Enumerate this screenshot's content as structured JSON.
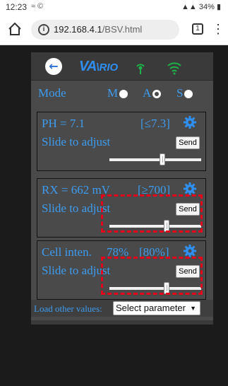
{
  "status_bar": {
    "time": "12:23",
    "icons": "≈ ©",
    "battery": "34%"
  },
  "browser": {
    "url_host": "192.168.4.1",
    "url_path": "/BSV.html",
    "tab_count": "1"
  },
  "app": {
    "logo": "VA",
    "logo_tail": "\\RIO",
    "mode": {
      "label": "Mode",
      "options": [
        {
          "label": "M",
          "selected": false
        },
        {
          "label": "A",
          "selected": true
        },
        {
          "label": "S",
          "selected": false
        }
      ]
    },
    "panels": [
      {
        "title": "PH = 7.1",
        "limit": "[≤7.3]",
        "subtitle": "Slide to adjust",
        "send": "Send",
        "slider_fraction": 0.58
      },
      {
        "title": "RX = 662 mV",
        "limit": "[≥700]",
        "subtitle": "Slide to adjust",
        "send": "Send",
        "slider_fraction": 0.62
      },
      {
        "title": "Cell inten.",
        "value": "78%",
        "limit": "[80%]",
        "subtitle": "Slide to adjust",
        "send": "Send",
        "slider_fraction": 0.62
      }
    ],
    "load": {
      "label": "Load other values:",
      "select_value": "Select parameter"
    }
  },
  "colors": {
    "accent": "#3d9cf0",
    "highlight": "#e2001a",
    "panel": "#4a4a4a"
  }
}
